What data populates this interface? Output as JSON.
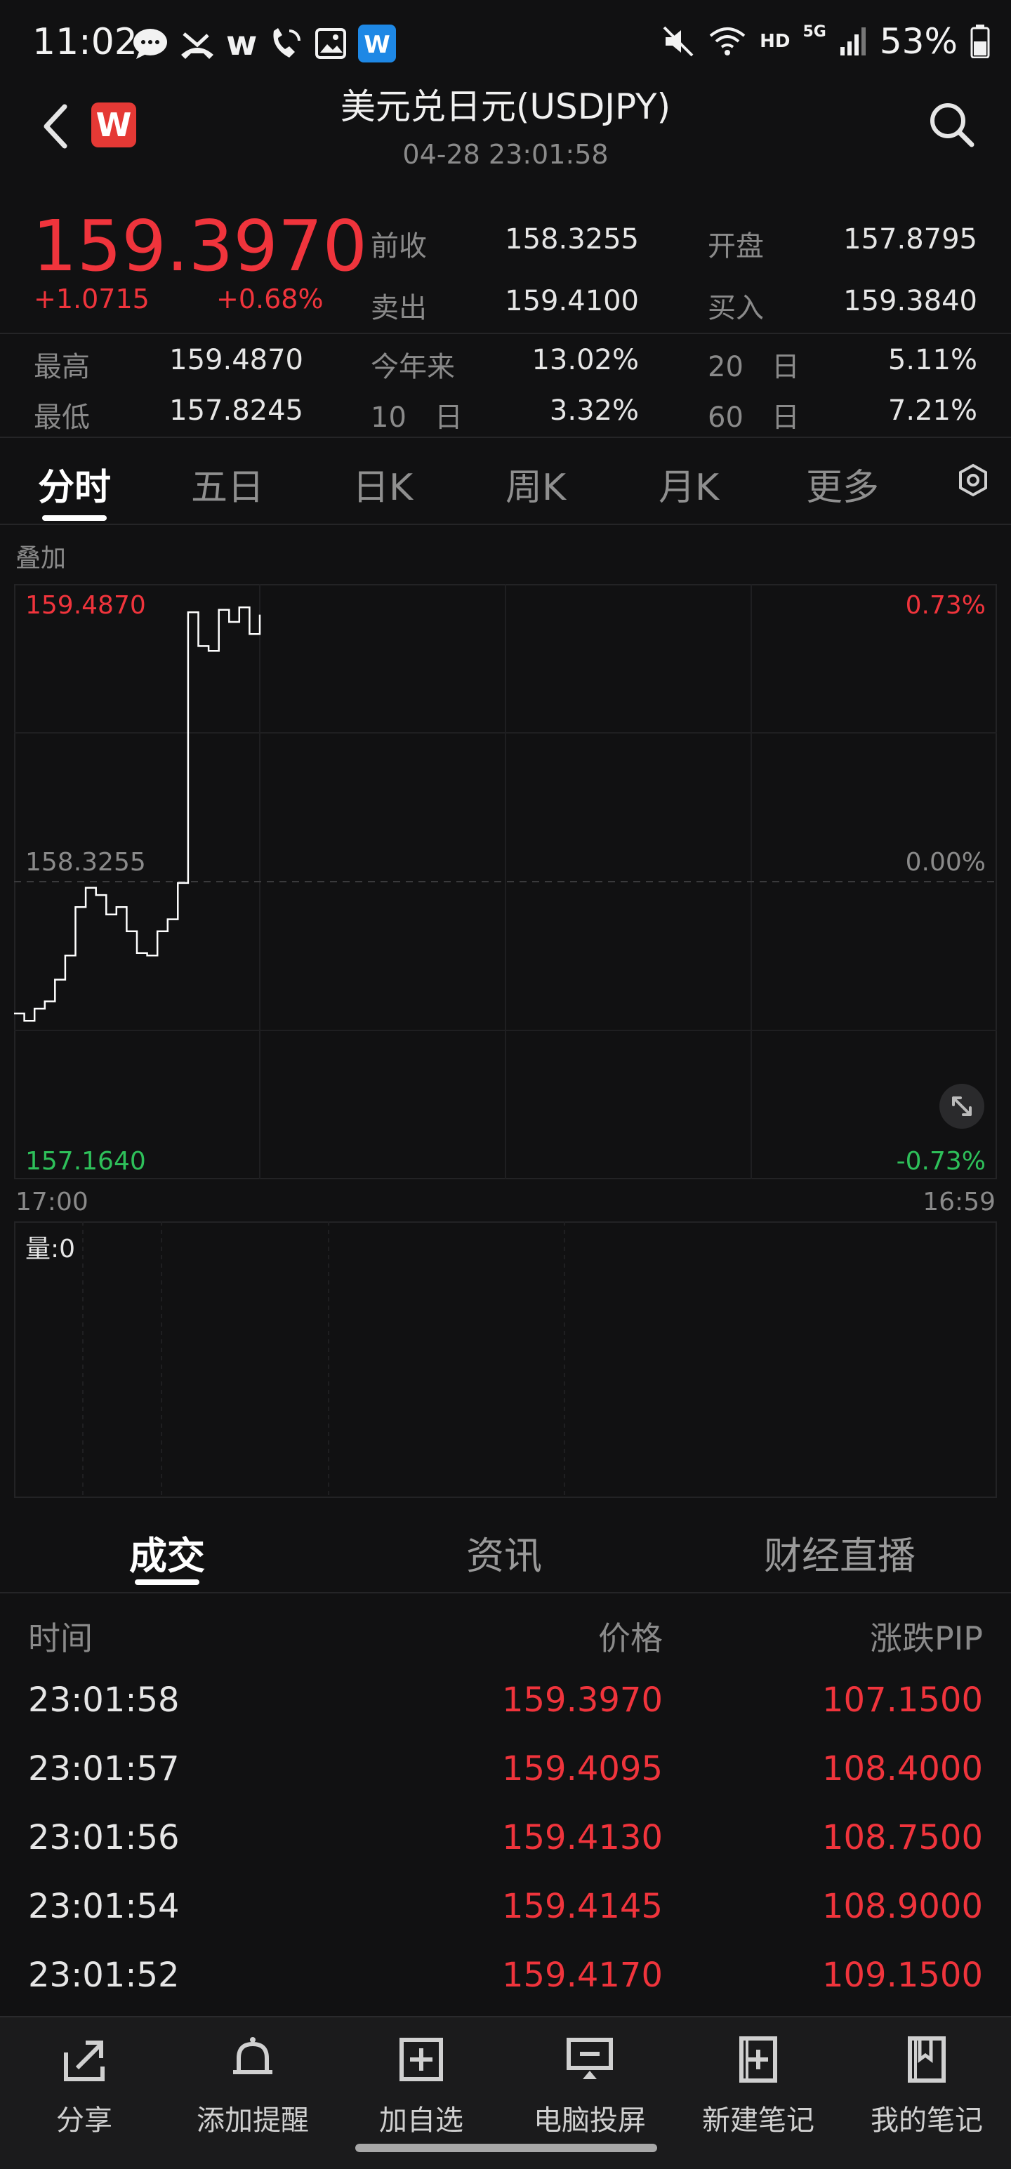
{
  "status_bar": {
    "time": "11:02",
    "notif_text": "w",
    "hd": "HD",
    "net": "5G",
    "battery": "53%"
  },
  "header": {
    "logo_text": "W",
    "title": "美元兑日元(USDJPY)",
    "subtitle": "04-28 23:01:58"
  },
  "quote": {
    "price": "159.3970",
    "change": "+1.0715",
    "change_pct": "+0.68%",
    "fields": [
      {
        "label": "前收",
        "value": "158.3255"
      },
      {
        "label": "开盘",
        "value": "157.8795"
      },
      {
        "label": "卖出",
        "value": "159.4100"
      },
      {
        "label": "买入",
        "value": "159.3840"
      },
      {
        "label": "最高",
        "value": "159.4870"
      },
      {
        "label": "今年来",
        "value": "13.02%"
      },
      {
        "label": "20　日",
        "value": "5.11%"
      },
      {
        "label": "最低",
        "value": "157.8245"
      },
      {
        "label": "10　日",
        "value": "3.32%"
      },
      {
        "label": "60　日",
        "value": "7.21%"
      }
    ]
  },
  "tabs": [
    "分时",
    "五日",
    "日K",
    "周K",
    "月K",
    "更多"
  ],
  "overlay_label": "叠加",
  "chart": {
    "high_label": "159.4870",
    "mid_label": "158.3255",
    "low_label": "157.1640",
    "high_pct": "0.73%",
    "mid_pct": "0.00%",
    "low_pct": "-0.73%",
    "time_start": "17:00",
    "time_end": "16:59",
    "volume_label": "量:0",
    "colors": {
      "line": "#ffffff",
      "up": "#f0343c",
      "down": "#2ec05a",
      "neutral": "#8a8a8a"
    }
  },
  "chart_data": {
    "type": "line",
    "x": [
      "17:00",
      "17:15",
      "17:30",
      "17:45",
      "18:00",
      "18:15",
      "18:30",
      "18:45",
      "19:00",
      "19:15",
      "19:30",
      "19:45",
      "20:00",
      "20:15",
      "20:30",
      "20:45",
      "21:00",
      "21:15",
      "21:30",
      "21:45",
      "22:00",
      "22:15",
      "22:30",
      "22:45",
      "23:00"
    ],
    "series": [
      {
        "values": [
          157.78,
          157.75,
          157.8,
          157.83,
          157.92,
          158.02,
          158.22,
          158.3,
          158.27,
          158.19,
          158.22,
          158.12,
          158.03,
          158.02,
          158.12,
          158.17,
          158.32,
          159.44,
          159.3,
          159.28,
          159.45,
          159.4,
          159.46,
          159.35,
          159.43
        ]
      }
    ],
    "ylim": [
      157.164,
      159.487
    ],
    "base": 158.3255,
    "xrange": [
      "17:00",
      "16:59"
    ],
    "grid": true
  },
  "lower_tabs": [
    "成交",
    "资讯",
    "财经直播"
  ],
  "table": {
    "headers": [
      "时间",
      "价格",
      "涨跌PIP"
    ],
    "rows": [
      [
        "23:01:58",
        "159.3970",
        "107.1500"
      ],
      [
        "23:01:57",
        "159.4095",
        "108.4000"
      ],
      [
        "23:01:56",
        "159.4130",
        "108.7500"
      ],
      [
        "23:01:54",
        "159.4145",
        "108.9000"
      ],
      [
        "23:01:52",
        "159.4170",
        "109.1500"
      ]
    ]
  },
  "bottom_nav": [
    {
      "label": "分享",
      "icon": "share-icon"
    },
    {
      "label": "添加提醒",
      "icon": "bell-icon"
    },
    {
      "label": "加自选",
      "icon": "add-box-icon"
    },
    {
      "label": "电脑投屏",
      "icon": "cast-screen-icon"
    },
    {
      "label": "新建笔记",
      "icon": "new-note-icon"
    },
    {
      "label": "我的笔记",
      "icon": "notebook-icon"
    }
  ]
}
